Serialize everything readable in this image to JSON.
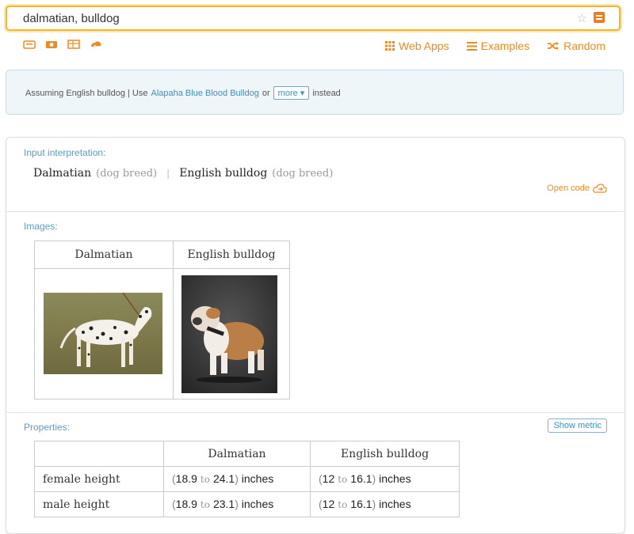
{
  "search": {
    "value": "dalmatian, bulldog"
  },
  "nav": {
    "web_apps": "Web Apps",
    "examples": "Examples",
    "random": "Random"
  },
  "assumption": {
    "prefix": "Assuming English bulldog | Use",
    "alt_link": "Alapaha Blue Blood Bulldog",
    "or": "or",
    "more": "more",
    "suffix": "instead"
  },
  "interpretation": {
    "title": "Input interpretation:",
    "item1": "Dalmatian",
    "item1_type": "(dog breed)",
    "divider": "|",
    "item2": "English bulldog",
    "item2_type": "(dog breed)",
    "open_code": "Open code"
  },
  "images": {
    "title": "Images:",
    "col1": "Dalmatian",
    "col2": "English bulldog"
  },
  "properties": {
    "title": "Properties:",
    "show_metric": "Show metric",
    "col1": "Dalmatian",
    "col2": "English bulldog",
    "to": "to",
    "rows": [
      {
        "label": "female height",
        "d_lo": "18.9",
        "d_hi": "24.1",
        "d_unit": "inches",
        "b_lo": "12",
        "b_hi": "16.1",
        "b_unit": "inches"
      },
      {
        "label": "male height",
        "d_lo": "18.9",
        "d_hi": "23.1",
        "d_unit": "inches",
        "b_lo": "12",
        "b_hi": "16.1",
        "b_unit": "inches"
      }
    ]
  },
  "colors": {
    "accent": "#f08a1d",
    "link": "#3b8fc4",
    "pod_title": "#5a9ec0"
  }
}
